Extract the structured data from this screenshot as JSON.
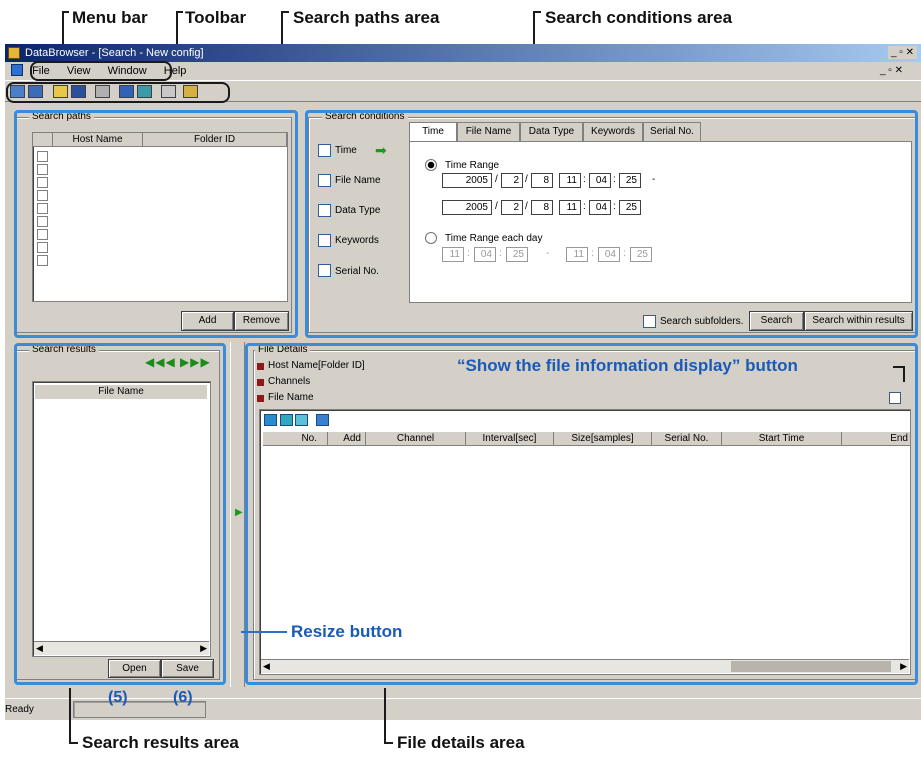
{
  "annotations": {
    "menu_bar": "Menu bar",
    "toolbar": "Toolbar",
    "search_paths_area": "Search paths area",
    "search_conditions_area": "Search conditions area",
    "show_file_info_button": "“Show the file information display” button",
    "resize_button": "Resize button",
    "search_results_area": "Search results area",
    "file_details_area": "File details area",
    "marker_5": "(5)",
    "marker_6": "(6)"
  },
  "window": {
    "title": "DataBrowser - [Search - New config]",
    "menu": [
      "File",
      "View",
      "Window",
      "Help"
    ],
    "status": "Ready"
  },
  "search_paths": {
    "title": "Search paths",
    "columns": [
      "Host Name",
      "Folder ID"
    ],
    "add_label": "Add",
    "remove_label": "Remove"
  },
  "search_conditions": {
    "title": "Search conditions",
    "checkboxes": [
      "Time",
      "File Name",
      "Data Type",
      "Keywords",
      "Serial No."
    ],
    "tabs": [
      "Time",
      "File Name",
      "Data Type",
      "Keywords",
      "Serial No."
    ],
    "time_range_label": "Time Range",
    "from": {
      "year": "2005",
      "month": "2",
      "day": "8",
      "hour": "11",
      "min": "04",
      "sec": "25"
    },
    "to": {
      "year": "2005",
      "month": "2",
      "day": "8",
      "hour": "11",
      "min": "04",
      "sec": "25"
    },
    "each_day_label": "Time Range each day",
    "each_from": {
      "hour": "11",
      "min": "04",
      "sec": "25"
    },
    "each_to": {
      "hour": "11",
      "min": "04",
      "sec": "25"
    },
    "sep_slash": "/",
    "sep_colon": ":",
    "dash": "-",
    "subfolders_label": "Search subfolders.",
    "search_label": "Search",
    "search_within_label": "Search within results"
  },
  "search_results": {
    "title": "Search results",
    "column": "File Name",
    "open_label": "Open",
    "save_label": "Save"
  },
  "file_details": {
    "title": "File Details",
    "items": [
      "Host Name[Folder ID]",
      "Channels",
      "File Name"
    ],
    "columns": [
      "No.",
      "Add",
      "Channel",
      "Interval[sec]",
      "Size[samples]",
      "Serial No.",
      "Start Time",
      "End"
    ]
  }
}
